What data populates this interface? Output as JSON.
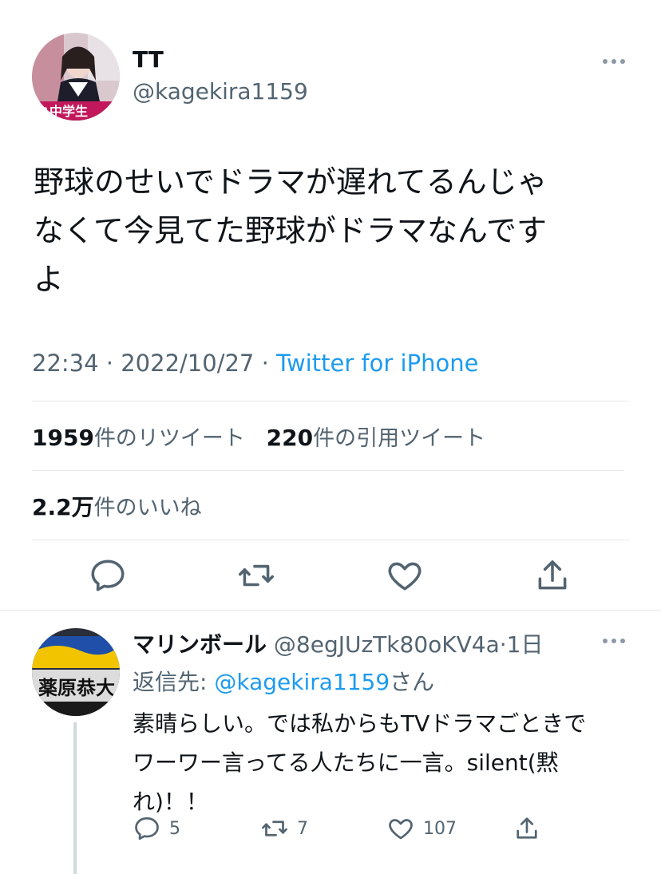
{
  "tweet": {
    "author": {
      "display_name": "TT",
      "handle": "@kagekira1159",
      "avatar_icon": "user-avatar-photo"
    },
    "text": "野球のせいでドラマが遅れてるんじゃ\nなくて今見てた野球がドラマなんです\nよ",
    "time": "22:34",
    "sep1": " · ",
    "date": "2022/10/27",
    "sep2": " · ",
    "source": "Twitter for iPhone",
    "retweets_count": "1959",
    "retweets_label": "件のリツイート",
    "quotes_count": "220",
    "quotes_label": "件の引用ツイート",
    "likes_count": "2.2万",
    "likes_label": "件のいいね",
    "actions": [
      "reply-icon",
      "retweet-icon",
      "like-icon",
      "share-icon"
    ]
  },
  "reply": {
    "display_name": "マリンボール",
    "handle": "@8egJUzTk80oKV4a",
    "time_sep": "·",
    "time": "1日",
    "reply_to_prefix": "返信先: ",
    "reply_to_handle": "@kagekira1159",
    "reply_to_suffix": "さん",
    "text": "素晴らしい。では私からもTVドラマごときで\nワーワー言ってる人たちに一言。silent(黙\nれ)！！",
    "counts": {
      "replies": "5",
      "retweets": "7",
      "likes": "107"
    }
  },
  "colors": {
    "accent": "#1d9bf0",
    "secondary_text": "#536471",
    "divider": "#e6e9eb"
  }
}
